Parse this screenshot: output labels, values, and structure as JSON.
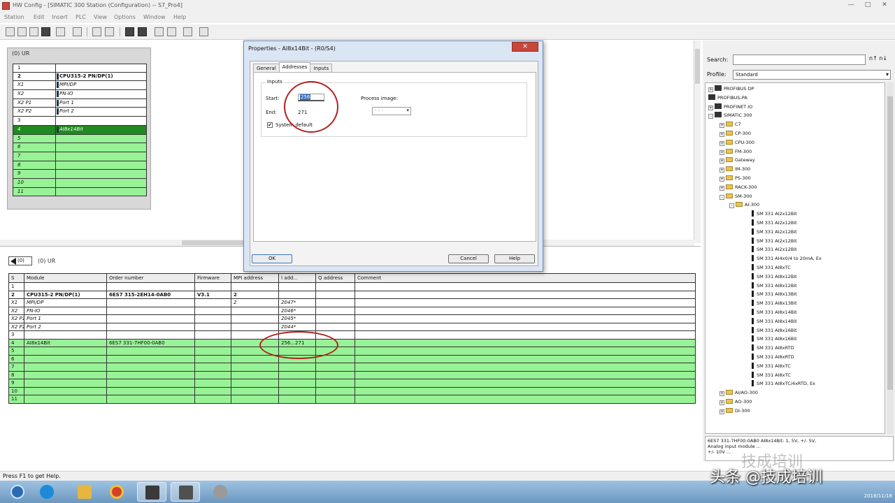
{
  "window": {
    "title": "HW Config - [SIMATIC 300 Station (Configuration) -- S7_Pro4]",
    "controls": [
      "—",
      "□",
      "✕"
    ]
  },
  "menu": [
    "Station",
    "Edit",
    "Insert",
    "PLC",
    "View",
    "Options",
    "Window",
    "Help"
  ],
  "rack": {
    "title": "(0) UR",
    "rows": [
      {
        "slot": "1",
        "name": "",
        "style": "normal"
      },
      {
        "slot": "2",
        "name": "CPU315-2 PN/DP(1)",
        "style": "bold"
      },
      {
        "slot": "X1",
        "name": "MPI/DP",
        "style": "italic"
      },
      {
        "slot": "X2",
        "name": "PN-IO",
        "style": "italic"
      },
      {
        "slot": "X2 P1",
        "name": "Port 1",
        "style": "italic"
      },
      {
        "slot": "X2 P2",
        "name": "Port 2",
        "style": "italic"
      },
      {
        "slot": "3",
        "name": "",
        "style": "normal"
      },
      {
        "slot": "4",
        "name": "AI8x14Bit",
        "style": "selected"
      },
      {
        "slot": "5",
        "name": "",
        "style": "green"
      },
      {
        "slot": "6",
        "name": "",
        "style": "green"
      },
      {
        "slot": "7",
        "name": "",
        "style": "green"
      },
      {
        "slot": "8",
        "name": "",
        "style": "green"
      },
      {
        "slot": "9",
        "name": "",
        "style": "green"
      },
      {
        "slot": "10",
        "name": "",
        "style": "green"
      },
      {
        "slot": "11",
        "name": "",
        "style": "green"
      }
    ]
  },
  "table_panel": {
    "nav_label": "(0)",
    "title": "(0) UR",
    "columns": [
      "S",
      "Module",
      "Order number",
      "Firmware",
      "MPI address",
      "I add...",
      "Q address",
      "Comment"
    ],
    "rows": [
      {
        "style": "normal",
        "cells": [
          "1",
          "",
          "",
          "",
          "",
          "",
          "",
          ""
        ]
      },
      {
        "style": "bold",
        "cells": [
          "2",
          "CPU315-2 PN/DP(1)",
          "6ES7 315-2EH14-0AB0",
          "V3.1",
          "2",
          "",
          "",
          ""
        ]
      },
      {
        "style": "ital",
        "cells": [
          "X1",
          "MPI/DP",
          "",
          "",
          "2",
          "2047*",
          "",
          ""
        ]
      },
      {
        "style": "ital",
        "cells": [
          "X2",
          "PN-IO",
          "",
          "",
          "",
          "2046*",
          "",
          ""
        ]
      },
      {
        "style": "ital",
        "cells": [
          "X2 P1",
          "Port 1",
          "",
          "",
          "",
          "2045*",
          "",
          ""
        ]
      },
      {
        "style": "ital",
        "cells": [
          "X2 P2",
          "Port 2",
          "",
          "",
          "",
          "2044*",
          "",
          ""
        ]
      },
      {
        "style": "normal",
        "cells": [
          "3",
          "",
          "",
          "",
          "",
          "",
          "",
          ""
        ]
      },
      {
        "style": "green",
        "cells": [
          "4",
          "AI8x14Bit",
          "6ES7 331-7HF00-0AB0",
          "",
          "",
          "256...271",
          "",
          ""
        ]
      },
      {
        "style": "green",
        "cells": [
          "5",
          "",
          "",
          "",
          "",
          "",
          "",
          ""
        ]
      },
      {
        "style": "green",
        "cells": [
          "6",
          "",
          "",
          "",
          "",
          "",
          "",
          ""
        ]
      },
      {
        "style": "green",
        "cells": [
          "7",
          "",
          "",
          "",
          "",
          "",
          "",
          ""
        ]
      },
      {
        "style": "green",
        "cells": [
          "8",
          "",
          "",
          "",
          "",
          "",
          "",
          ""
        ]
      },
      {
        "style": "green",
        "cells": [
          "9",
          "",
          "",
          "",
          "",
          "",
          "",
          ""
        ]
      },
      {
        "style": "green",
        "cells": [
          "10",
          "",
          "",
          "",
          "",
          "",
          "",
          ""
        ]
      },
      {
        "style": "green",
        "cells": [
          "11",
          "",
          "",
          "",
          "",
          "",
          "",
          ""
        ]
      }
    ]
  },
  "dialog": {
    "title": "Properties - AI8x14Bit - (R0/S4)",
    "close": "✕",
    "tabs": [
      "General",
      "Addresses",
      "Inputs"
    ],
    "group_label": "Inputs",
    "start_label": "Start:",
    "start_value": "256",
    "end_label": "End:",
    "end_value": "271",
    "system_default_label": "System default",
    "system_default_checked": "✔",
    "process_image_label": "Process image:",
    "process_image_value": "- - -",
    "ok": "OK",
    "cancel": "Cancel",
    "help": "Help"
  },
  "catalog": {
    "search_label": "Search:",
    "search_value": "",
    "search_buttons": "n↑ n↓",
    "profile_label": "Profile:",
    "profile_value": "Standard",
    "tree": [
      {
        "label": "PROFIBUS DP",
        "kind": "net",
        "exp": "+"
      },
      {
        "label": "PROFIBUS-PA",
        "kind": "net",
        "exp": ""
      },
      {
        "label": "PROFINET IO",
        "kind": "net",
        "exp": "+"
      },
      {
        "label": "SIMATIC 300",
        "kind": "net",
        "exp": "-"
      },
      {
        "label": "C7",
        "kind": "fld",
        "exp": "+"
      },
      {
        "label": "CP-300",
        "kind": "fld",
        "exp": "+"
      },
      {
        "label": "CPU-300",
        "kind": "fld",
        "exp": "+"
      },
      {
        "label": "FM-300",
        "kind": "fld",
        "exp": "+"
      },
      {
        "label": "Gateway",
        "kind": "fld",
        "exp": "+"
      },
      {
        "label": "IM-300",
        "kind": "fld",
        "exp": "+"
      },
      {
        "label": "PS-300",
        "kind": "fld",
        "exp": "+"
      },
      {
        "label": "RACK-300",
        "kind": "fld",
        "exp": "+"
      },
      {
        "label": "SM-300",
        "kind": "fld",
        "exp": "-"
      },
      {
        "label": "AI-300",
        "kind": "fld",
        "exp": "-"
      },
      {
        "label": "SM 331 AI2x12Bit",
        "kind": "mod",
        "exp": ""
      },
      {
        "label": "SM 331 AI2x12Bit",
        "kind": "mod",
        "exp": ""
      },
      {
        "label": "SM 331 AI2x12Bit",
        "kind": "mod",
        "exp": ""
      },
      {
        "label": "SM 331 AI2x12Bit",
        "kind": "mod",
        "exp": ""
      },
      {
        "label": "SM 331 AI2x12Bit",
        "kind": "mod",
        "exp": ""
      },
      {
        "label": "SM 331 AI4x0/4 to 20mA, Ex",
        "kind": "mod",
        "exp": ""
      },
      {
        "label": "SM 331 AI8xTC",
        "kind": "mod",
        "exp": ""
      },
      {
        "label": "SM 331 AI8x12Bit",
        "kind": "mod",
        "exp": ""
      },
      {
        "label": "SM 331 AI8x12Bit",
        "kind": "mod",
        "exp": ""
      },
      {
        "label": "SM 331 AI8x13Bit",
        "kind": "mod",
        "exp": ""
      },
      {
        "label": "SM 331 AI8x13Bit",
        "kind": "mod",
        "exp": ""
      },
      {
        "label": "SM 331 AI8x14Bit",
        "kind": "mod",
        "exp": ""
      },
      {
        "label": "SM 331 AI8x14Bit",
        "kind": "mod",
        "exp": ""
      },
      {
        "label": "SM 331 AI8x16Bit",
        "kind": "mod",
        "exp": ""
      },
      {
        "label": "SM 331 AI8x16Bit",
        "kind": "mod",
        "exp": ""
      },
      {
        "label": "SM 331 AI8xRTD",
        "kind": "mod",
        "exp": ""
      },
      {
        "label": "SM 331 AI8xRTD",
        "kind": "mod",
        "exp": ""
      },
      {
        "label": "SM 331 AI8xTC",
        "kind": "mod",
        "exp": ""
      },
      {
        "label": "SM 331 AI8xTC",
        "kind": "mod",
        "exp": ""
      },
      {
        "label": "SM 331 AI8xTC/4xRTD, Ex",
        "kind": "mod",
        "exp": ""
      },
      {
        "label": "AI/AO-300",
        "kind": "fld",
        "exp": "+"
      },
      {
        "label": "AO-300",
        "kind": "fld",
        "exp": "+"
      },
      {
        "label": "DI-300",
        "kind": "fld",
        "exp": "+"
      }
    ],
    "info_line1": "6ES7 331-7HF00-0AB0          AI8x14Bit: 1, 5V, +/- 5V,",
    "info_line2": "Analog input module ...",
    "info_line3": "+/- 10V ..."
  },
  "statusbar": "Press F1 to get Help.",
  "taskbar": {
    "clock_date": "2018/11/18"
  },
  "watermark": {
    "text": "头条 @技成培训",
    "ghost": "技成培训"
  }
}
